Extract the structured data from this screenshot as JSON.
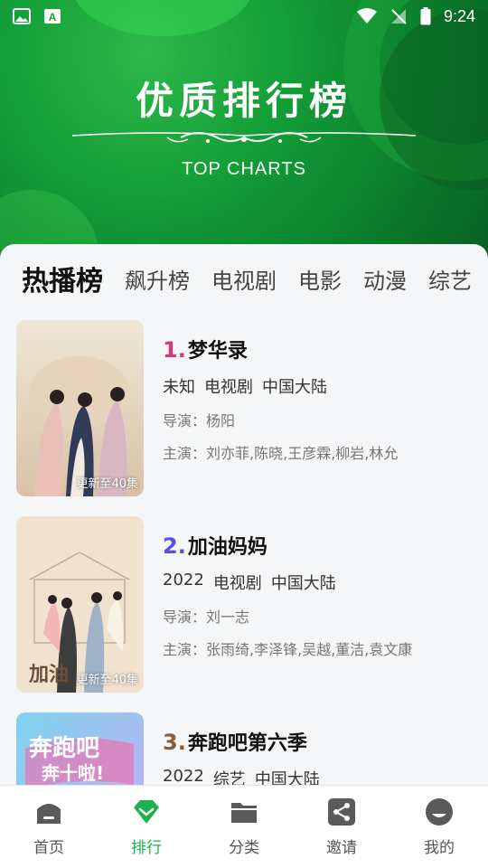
{
  "status_bar": {
    "time": "9:24",
    "left_icons": [
      "image-icon",
      "a-icon"
    ],
    "right_icons": [
      "wifi-icon",
      "no-signal-icon",
      "battery-icon"
    ]
  },
  "hero": {
    "title": "优质排行榜",
    "subtitle": "TOP CHARTS"
  },
  "tabs": [
    {
      "label": "热播榜",
      "active": true
    },
    {
      "label": "飙升榜",
      "active": false
    },
    {
      "label": "电视剧",
      "active": false
    },
    {
      "label": "电影",
      "active": false
    },
    {
      "label": "动漫",
      "active": false
    },
    {
      "label": "综艺",
      "active": false
    }
  ],
  "items": [
    {
      "rank": "1.",
      "rank_color": "#e0357a",
      "title": "梦华录",
      "year": "未知",
      "type": "电视剧",
      "region": "中国大陆",
      "director_label": "导演：",
      "director": "杨阳",
      "cast_label": "主演：",
      "cast": "刘亦菲,陈晓,王彦霖,柳岩,林允",
      "badge": "更新至40集"
    },
    {
      "rank": "2.",
      "rank_color": "#5a4fe0",
      "title": "加油妈妈",
      "year": "2022",
      "type": "电视剧",
      "region": "中国大陆",
      "director_label": "导演：",
      "director": "刘一志",
      "cast_label": "主演：",
      "cast": "张雨绮,李泽锋,吴越,董洁,袁文康",
      "badge": "更新至40集"
    },
    {
      "rank": "3.",
      "rank_color": "#8a5a3a",
      "title": "奔跑吧第六季",
      "year": "2022",
      "type": "综艺",
      "region": "中国大陆",
      "director_label": "",
      "director": "",
      "cast_label": "",
      "cast": "",
      "badge": ""
    }
  ],
  "bottom_nav": [
    {
      "label": "首页",
      "icon": "home-icon",
      "active": false
    },
    {
      "label": "排行",
      "icon": "diamond-icon",
      "active": true
    },
    {
      "label": "分类",
      "icon": "folder-icon",
      "active": false
    },
    {
      "label": "邀请",
      "icon": "share-icon",
      "active": false
    },
    {
      "label": "我的",
      "icon": "profile-icon",
      "active": false
    }
  ],
  "colors": {
    "accent": "#1fb14a",
    "hero_green": "#139e37"
  }
}
